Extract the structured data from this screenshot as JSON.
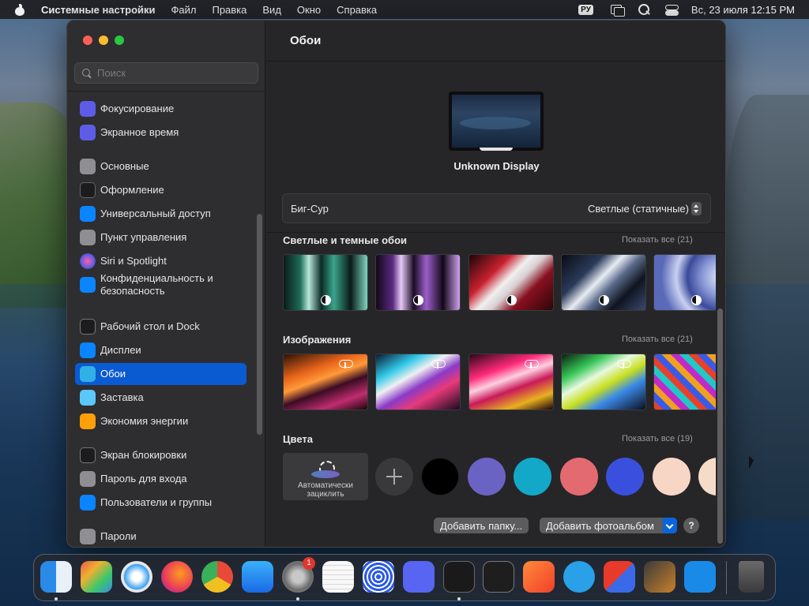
{
  "menubar": {
    "app_name": "Системные настройки",
    "menus": [
      "Файл",
      "Правка",
      "Вид",
      "Окно",
      "Справка"
    ],
    "input_source": "РУ",
    "datetime": "Вс, 23 июля  12:15 PM"
  },
  "sidebar": {
    "search_placeholder": "Поиск",
    "items": [
      {
        "label": "Фокусирование",
        "icon": "moon-icon",
        "color": "#5e5ce6"
      },
      {
        "label": "Экранное время",
        "icon": "hourglass-icon",
        "color": "#5e5ce6"
      },
      {
        "label": "Основные",
        "icon": "gear-icon",
        "color": "#8e8e93"
      },
      {
        "label": "Оформление",
        "icon": "appearance-icon",
        "color": "#1c1c1e"
      },
      {
        "label": "Универсальный доступ",
        "icon": "accessibility-icon",
        "color": "#0a84ff"
      },
      {
        "label": "Пункт управления",
        "icon": "control-center-icon",
        "color": "#8e8e93"
      },
      {
        "label": "Siri и Spotlight",
        "icon": "siri-icon",
        "color": "#bf5af2"
      },
      {
        "label": "Конфиденциальность и безопасность",
        "icon": "hand-icon",
        "color": "#0a84ff"
      },
      {
        "label": "Рабочий стол и Dock",
        "icon": "dock-icon",
        "color": "#1c1c1e"
      },
      {
        "label": "Дисплеи",
        "icon": "sun-icon",
        "color": "#0a84ff"
      },
      {
        "label": "Обои",
        "icon": "wallpaper-icon",
        "color": "#30b0e6"
      },
      {
        "label": "Заставка",
        "icon": "screensaver-icon",
        "color": "#5ac8fa"
      },
      {
        "label": "Экономия энергии",
        "icon": "lightbulb-icon",
        "color": "#ff9f0a"
      },
      {
        "label": "Экран блокировки",
        "icon": "lock-icon",
        "color": "#1c1c1e"
      },
      {
        "label": "Пароль для входа",
        "icon": "lock-icon",
        "color": "#8e8e93"
      },
      {
        "label": "Пользователи и группы",
        "icon": "users-icon",
        "color": "#0a84ff"
      },
      {
        "label": "Пароли",
        "icon": "key-icon",
        "color": "#8e8e93"
      }
    ],
    "active_index": 10
  },
  "main": {
    "title": "Обои",
    "display_name": "Unknown Display",
    "wallpaper_name": "Биг-Сур",
    "wallpaper_mode": "Светлые (статичные)",
    "sections": [
      {
        "title": "Светлые и темные обои",
        "more": "Показать все (21)"
      },
      {
        "title": "Изображения",
        "more": "Показать все (21)"
      },
      {
        "title": "Цвета",
        "more": "Показать все (19)"
      }
    ],
    "auto_rotate_label": "Автоматически зациклить",
    "swatch_colors": [
      "#000000",
      "#6b63c4",
      "#14a8c8",
      "#e46a72",
      "#3b4fde",
      "#f8d6c6",
      "#f4dcc8"
    ],
    "add_folder": "Добавить папку...",
    "add_album": "Добавить фотоальбом",
    "help": "?"
  },
  "dock": {
    "apps": [
      "finder-icon",
      "launchpad-icon",
      "safari-icon",
      "firefox-icon",
      "chrome-icon",
      "app-store-icon",
      "system-settings-icon",
      "textedit-icon",
      "simulator-icon",
      "discord-icon",
      "terminal-icon",
      "console-icon",
      "swift-playgrounds-icon",
      "telegram-icon",
      "parallels-icon",
      "garageband-icon",
      "vscode-icon",
      "trash-icon"
    ],
    "settings_badge": "1"
  }
}
